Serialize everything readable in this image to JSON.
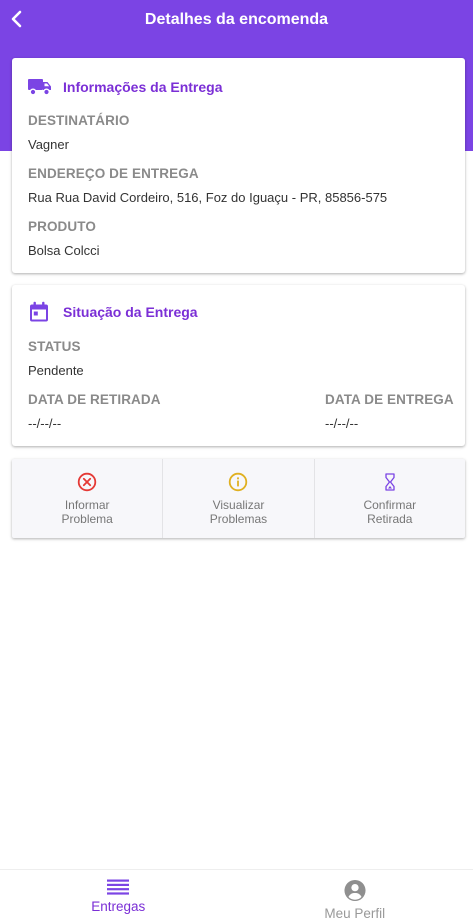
{
  "header": {
    "title": "Detalhes da encomenda"
  },
  "delivery_info": {
    "title": "Informações da Entrega",
    "recipient_label": "DESTINATÁRIO",
    "recipient_value": "Vagner",
    "address_label": "ENDEREÇO DE ENTREGA",
    "address_value": "Rua Rua David Cordeiro, 516, Foz do Iguaçu - PR, 85856-575",
    "product_label": "PRODUTO",
    "product_value": "Bolsa Colcci"
  },
  "delivery_status": {
    "title": "Situação da Entrega",
    "status_label": "STATUS",
    "status_value": "Pendente",
    "pickup_date_label": "DATA DE RETIRADA",
    "pickup_date_value": "--/--/--",
    "delivery_date_label": "DATA DE ENTREGA",
    "delivery_date_value": "--/--/--"
  },
  "actions": {
    "report_problem": "Informar Problema",
    "view_problems": "Visualizar Problemas",
    "confirm_pickup": "Confirmar Retirada"
  },
  "bottom_nav": {
    "deliveries": "Entregas",
    "profile": "Meu Perfil"
  },
  "colors": {
    "primary": "#7b44e4",
    "accent_text": "#7b2fd6",
    "error": "#e53935",
    "warning": "#e0b020"
  },
  "icons": {
    "back": "arrow-back-icon",
    "truck": "truck-icon",
    "calendar": "calendar-icon",
    "error": "error-circle-icon",
    "info": "info-circle-icon",
    "hourglass": "hourglass-icon",
    "list": "list-icon",
    "account": "account-circle-icon"
  }
}
